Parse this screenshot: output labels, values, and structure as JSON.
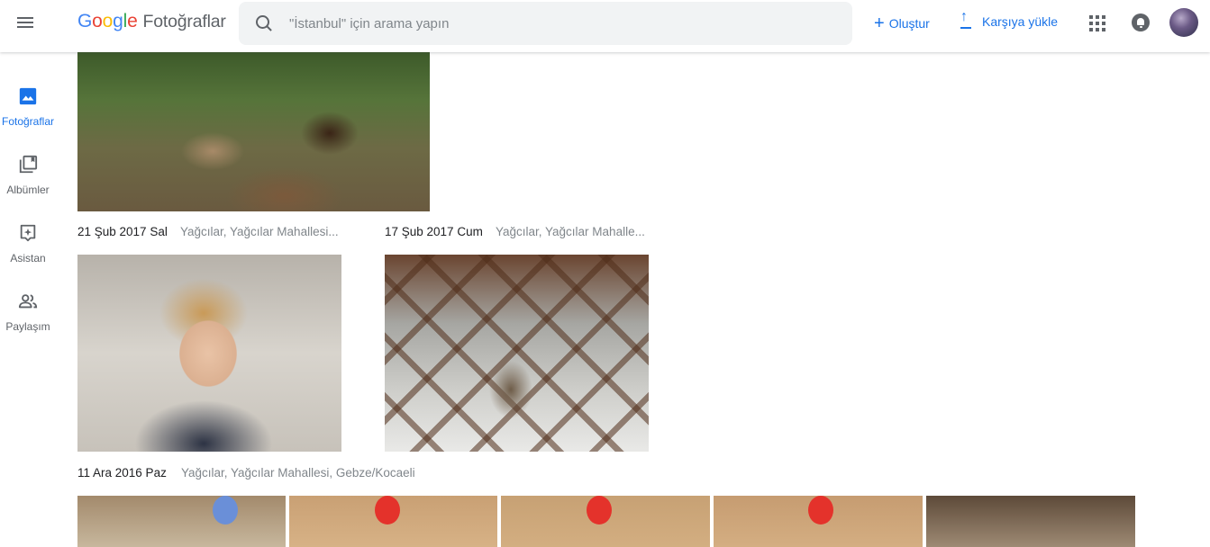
{
  "header": {
    "logo_google": [
      "G",
      "o",
      "o",
      "g",
      "l",
      "e"
    ],
    "logo_colors": [
      "#4285f4",
      "#ea4335",
      "#fbbc05",
      "#4285f4",
      "#34a853",
      "#ea4335"
    ],
    "product_name": "Fotoğraflar",
    "search_placeholder": "\"İstanbul\" için arama yapın",
    "create_label": "Oluştur",
    "upload_label": "Karşıya yükle",
    "icons": [
      "menu-icon",
      "search-icon",
      "plus-icon",
      "upload-icon",
      "apps-icon",
      "bell-icon",
      "avatar"
    ]
  },
  "sidebar": {
    "items": [
      {
        "label": "Fotoğraflar",
        "icon": "photo-icon",
        "active": true
      },
      {
        "label": "Albümler",
        "icon": "album-icon",
        "active": false
      },
      {
        "label": "Asistan",
        "icon": "assistant-icon",
        "active": false
      },
      {
        "label": "Paylaşım",
        "icon": "sharing-icon",
        "active": false
      }
    ]
  },
  "groups": [
    {
      "date": "21 Şub 2017 Sal",
      "location": "Yağcılar, Yağcılar Mahallesi..."
    },
    {
      "date": "17 Şub 2017 Cum",
      "location": "Yağcılar, Yağcılar Mahalle..."
    },
    {
      "date": "11 Ara 2016 Paz",
      "location": "Yağcılar, Yağcılar Mahallesi, Gebze/Kocaeli"
    }
  ],
  "colors": {
    "accent": "#1a73e8",
    "icon_gray": "#5f6368",
    "search_bg": "#f1f3f4"
  }
}
